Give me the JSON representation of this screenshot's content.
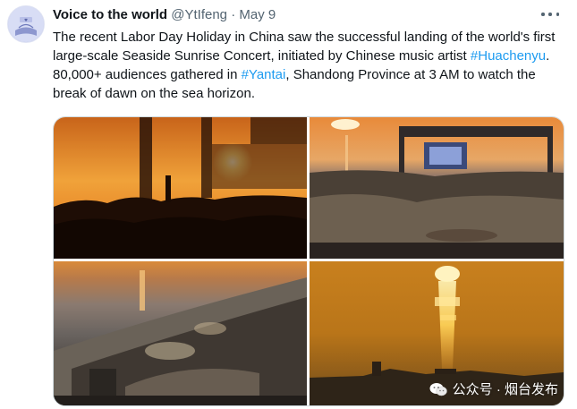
{
  "tweet": {
    "author_name": "Voice to the world",
    "handle": "@YtIfeng",
    "separator": "·",
    "date": "May 9",
    "text_parts": {
      "p1": "The recent Labor Day Holiday in China saw the successful landing of the world's first large-scale Seaside Sunrise Concert, initiated by Chinese music artist ",
      "tag1": "#Huachenyu",
      "p2": ". 80,000+ audiences gathered in ",
      "tag2": "#Yantai",
      "p3": ", Shandong Province at 3 AM to watch the break of dawn on the sea horizon."
    },
    "more_icon": "more-dots-icon",
    "media": {
      "photo_count": 4,
      "photos": [
        {
          "name": "concert-crowd-sunrise-photo"
        },
        {
          "name": "concert-stage-sea-photo"
        },
        {
          "name": "aerial-beach-concert-photo"
        },
        {
          "name": "sunrise-over-sea-photo"
        }
      ],
      "watermark": "公众号 · 烟台发布",
      "watermark_icon": "wechat-icon"
    },
    "colors": {
      "link": "#1d9bf0",
      "muted": "#536471",
      "text": "#0f1419"
    }
  }
}
